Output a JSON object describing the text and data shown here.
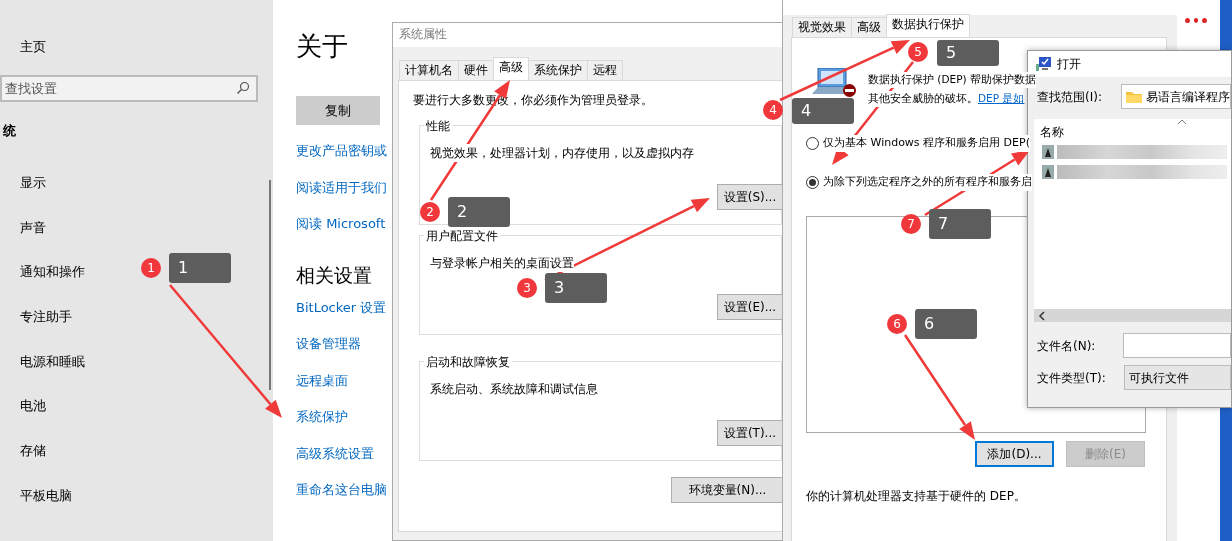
{
  "settings": {
    "home": "主页",
    "search": {
      "placeholder": "查找设置"
    },
    "section": "统",
    "nav_items": [
      "显示",
      "声音",
      "通知和操作",
      "专注助手",
      "电源和睡眠",
      "电池",
      "存储",
      "平板电脑"
    ],
    "page_title": "关于",
    "copy_button": "复制",
    "links": [
      "更改产品密钥或",
      "阅读适用于我们",
      "阅读 Microsoft"
    ],
    "related_heading": "相关设置",
    "related_links": [
      "BitLocker 设置",
      "设备管理器",
      "远程桌面",
      "系统保护",
      "高级系统设置",
      "重命名这台电脑"
    ]
  },
  "system_properties": {
    "title": "系统属性",
    "tabs": [
      {
        "label": "计算机名",
        "selected": false
      },
      {
        "label": "硬件",
        "selected": false
      },
      {
        "label": "高级",
        "selected": true
      },
      {
        "label": "系统保护",
        "selected": false
      },
      {
        "label": "远程",
        "selected": false
      }
    ],
    "admin_note": "要进行大多数更改，你必须作为管理员登录。",
    "groups": [
      {
        "title": "性能",
        "description": "视觉效果，处理器计划，内存使用，以及虚拟内存",
        "button": "设置(S)..."
      },
      {
        "title": "用户配置文件",
        "description": "与登录帐户相关的桌面设置",
        "button": "设置(E)..."
      },
      {
        "title": "启动和故障恢复",
        "description": "系统启动、系统故障和调试信息",
        "button": "设置(T)..."
      }
    ],
    "env_button": "环境变量(N)..."
  },
  "performance_options": {
    "tabs": [
      {
        "label": "视觉效果",
        "selected": false
      },
      {
        "label": "高级",
        "selected": false
      },
      {
        "label": "数据执行保护",
        "selected": true
      }
    ],
    "intro_line1": "数据执行保护 (DEP) 帮助保护数据",
    "intro_line2": "其他安全威胁的破坏。",
    "intro_link": "DEP 是如",
    "options": [
      {
        "label": "仅为基本 Windows 程序和服务启用 DEP(",
        "selected": false
      },
      {
        "label": "为除下列选定程序之外的所有程序和服务启",
        "selected": true
      }
    ],
    "buttons": [
      {
        "label": "添加(D)...",
        "disabled": false
      },
      {
        "label": "删除(E)",
        "disabled": true
      }
    ],
    "footer": "你的计算机处理器支持基于硬件的 DEP。"
  },
  "open_dialog": {
    "title": "打开",
    "look_in_label": "查找范围(I):",
    "look_in_value": "易语言编译程序",
    "column": "名称",
    "file_name_label": "文件名(N):",
    "file_type_label": "文件类型(T):",
    "file_type_value": "可执行文件"
  },
  "annotations": [
    {
      "badge": "1",
      "label": "1"
    },
    {
      "badge": "2",
      "label": "2"
    },
    {
      "badge": "3",
      "label": "3"
    },
    {
      "badge": "4",
      "label": "4"
    },
    {
      "badge": "5",
      "label": "5"
    },
    {
      "badge": "7",
      "label": "7"
    },
    {
      "badge": "6",
      "label": "6"
    }
  ]
}
